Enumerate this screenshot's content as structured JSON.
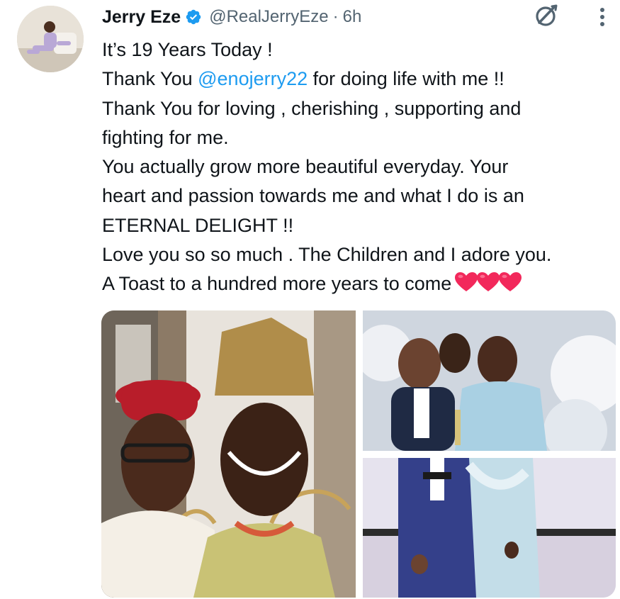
{
  "tweet": {
    "author": {
      "name": "Jerry Eze",
      "handle": "@RealJerryEze",
      "verified": true,
      "avatar_icon": "profile-photo"
    },
    "separator": "·",
    "time": "6h",
    "lines": [
      "It’s 19 Years Today !",
      "for doing life with me !!",
      "Thank You for loving , cherishing , supporting and",
      "fighting for me.",
      "You actually grow more beautiful everyday. Your",
      "heart and passion towards me and what I do is an",
      "ETERNAL DELIGHT !!",
      "Love you so so much . The Children and I adore you.",
      "A Toast to a hundred more years to come"
    ],
    "mention_prefix": "Thank You ",
    "mention": "@enojerry22",
    "emoji": [
      "red-heart",
      "red-heart",
      "red-heart"
    ],
    "media": [
      {
        "kind": "photo",
        "description_icon": "traditional-wedding-photo"
      },
      {
        "kind": "photo",
        "description_icon": "celebration-table-photo"
      },
      {
        "kind": "photo",
        "description_icon": "couple-standing-photo"
      }
    ]
  },
  "icons": {
    "verified": "verified-badge-icon",
    "grok": "grok-icon",
    "more": "more-options-icon"
  },
  "colors": {
    "text": "#0f1419",
    "muted": "#536471",
    "link": "#1d9bf0",
    "verified": "#1d9bf0",
    "heart": "#f2285b"
  }
}
